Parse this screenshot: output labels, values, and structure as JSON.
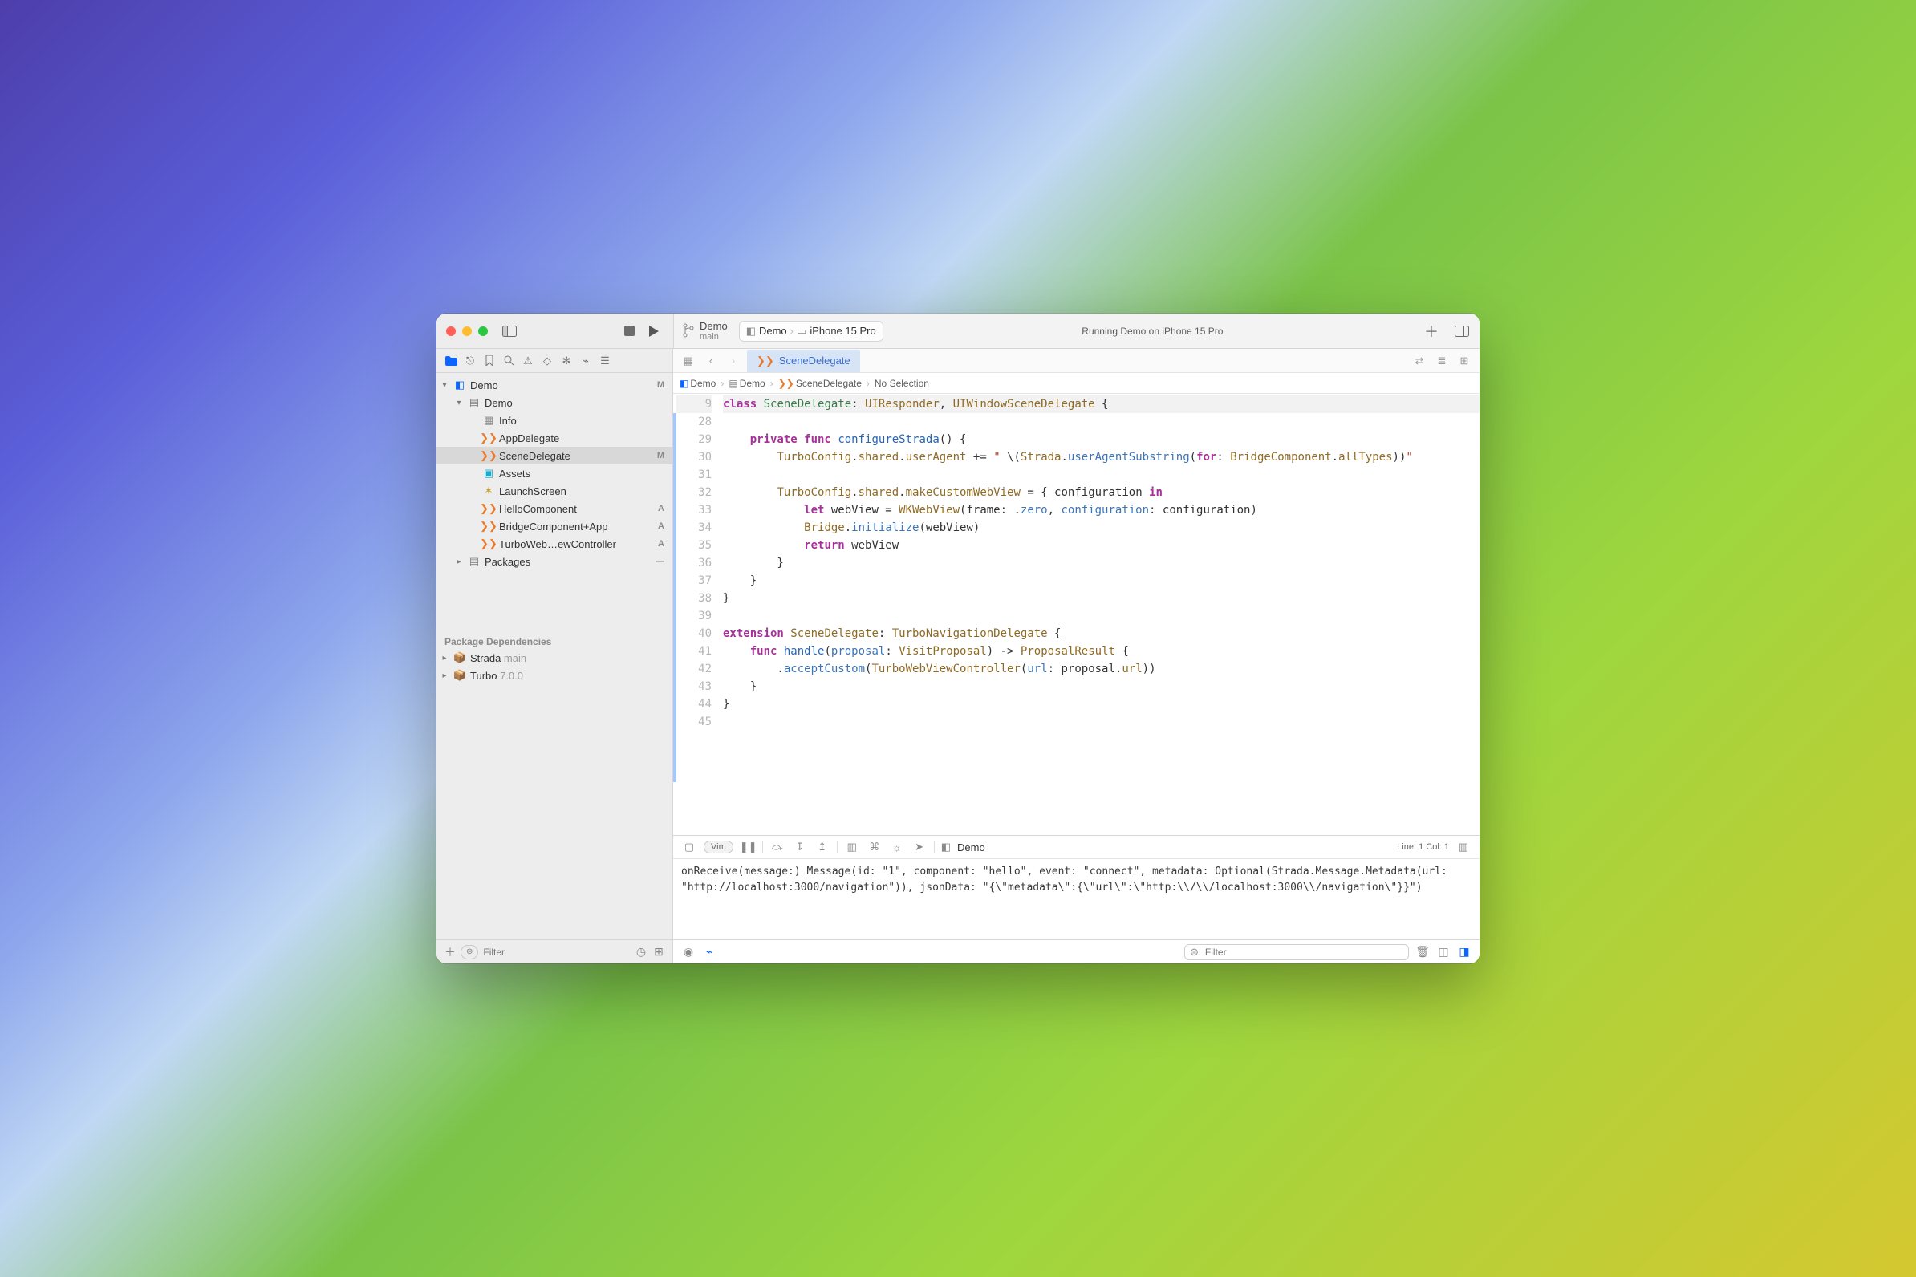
{
  "titlebar": {
    "branch_name": "Demo",
    "branch_sub": "main",
    "scheme_target": "Demo",
    "scheme_device": "iPhone 15 Pro",
    "status": "Running Demo on iPhone 15 Pro"
  },
  "sidebar": {
    "filter_placeholder": "Filter",
    "items": [
      {
        "depth": 0,
        "chev": "▾",
        "icon": "app",
        "label": "Demo",
        "badge": "M",
        "selected": false
      },
      {
        "depth": 1,
        "chev": "▾",
        "icon": "folder",
        "label": "Demo",
        "badge": "",
        "selected": false
      },
      {
        "depth": 2,
        "chev": "",
        "icon": "grid",
        "label": "Info",
        "badge": "",
        "selected": false
      },
      {
        "depth": 2,
        "chev": "",
        "icon": "swift",
        "label": "AppDelegate",
        "badge": "",
        "selected": false
      },
      {
        "depth": 2,
        "chev": "",
        "icon": "swift",
        "label": "SceneDelegate",
        "badge": "M",
        "selected": true
      },
      {
        "depth": 2,
        "chev": "",
        "icon": "assets",
        "label": "Assets",
        "badge": "",
        "selected": false
      },
      {
        "depth": 2,
        "chev": "",
        "icon": "storyboard",
        "label": "LaunchScreen",
        "badge": "",
        "selected": false
      },
      {
        "depth": 2,
        "chev": "",
        "icon": "swift",
        "label": "HelloComponent",
        "badge": "A",
        "selected": false
      },
      {
        "depth": 2,
        "chev": "",
        "icon": "swift",
        "label": "BridgeComponent+App",
        "badge": "A",
        "selected": false
      },
      {
        "depth": 2,
        "chev": "",
        "icon": "swift",
        "label": "TurboWeb…ewController",
        "badge": "A",
        "selected": false
      },
      {
        "depth": 1,
        "chev": "▸",
        "icon": "folder",
        "label": "Packages",
        "badge": "—",
        "selected": false
      }
    ],
    "deps_title": "Package Dependencies",
    "deps": [
      {
        "name": "Strada",
        "ver": "main"
      },
      {
        "name": "Turbo",
        "ver": "7.0.0"
      }
    ]
  },
  "tabs": {
    "active": "SceneDelegate"
  },
  "jumpbar": [
    "Demo",
    "Demo",
    "SceneDelegate",
    "No Selection"
  ],
  "editor": {
    "first_line_no": 9,
    "line_count": 16,
    "lines": [
      {
        "n": 9,
        "hl": true,
        "html": "<span class='kw'>class</span> <span class='type'>SceneDelegate</span>: <span class='attr'>UIResponder</span>, <span class='attr'>UIWindowSceneDelegate</span> {"
      },
      {
        "n": 28,
        "html": ""
      },
      {
        "n": 29,
        "html": "    <span class='kw'>private func</span> <span class='fn'>configureStrada</span>() {"
      },
      {
        "n": 30,
        "html": "        <span class='attr'>TurboConfig</span>.<span class='attr'>shared</span>.<span class='attr'>userAgent</span> += <span class='str'>\" </span>\\(<span class='attr'>Strada</span>.<span class='ident'>userAgentSubstring</span>(<span class='kw'>for</span>: <span class='attr'>BridgeComponent</span>.<span class='attr'>allTypes</span>))<span class='str'>\"</span>"
      },
      {
        "n": 31,
        "html": ""
      },
      {
        "n": 32,
        "html": "        <span class='attr'>TurboConfig</span>.<span class='attr'>shared</span>.<span class='attr'>makeCustomWebView</span> = { configuration <span class='kw'>in</span>"
      },
      {
        "n": 33,
        "html": "            <span class='kw'>let</span> webView = <span class='attr'>WKWebView</span>(frame: .<span class='ident'>zero</span>, <span class='ident'>configuration</span>: configuration)"
      },
      {
        "n": 34,
        "html": "            <span class='attr'>Bridge</span>.<span class='ident'>initialize</span>(webView)"
      },
      {
        "n": 35,
        "html": "            <span class='kw'>return</span> webView"
      },
      {
        "n": 36,
        "html": "        }"
      },
      {
        "n": 37,
        "html": "    }"
      },
      {
        "n": 38,
        "html": "}"
      },
      {
        "n": 39,
        "html": ""
      },
      {
        "n": 40,
        "html": "<span class='kw'>extension</span> <span class='attr'>SceneDelegate</span>: <span class='attr'>TurboNavigationDelegate</span> {"
      },
      {
        "n": 41,
        "html": "    <span class='kw'>func</span> <span class='fn'>handle</span>(<span class='ident'>proposal</span>: <span class='attr'>VisitProposal</span>) -> <span class='attr'>ProposalResult</span> {"
      },
      {
        "n": 42,
        "html": "        .<span class='ident'>acceptCustom</span>(<span class='attr'>TurboWebViewController</span>(<span class='ident'>url</span>: proposal.<span class='attr'>url</span>))"
      },
      {
        "n": 43,
        "html": "    }"
      },
      {
        "n": 44,
        "html": "}"
      },
      {
        "n": 45,
        "html": ""
      }
    ]
  },
  "debug": {
    "mode_label": "Vim",
    "process": "Demo",
    "cursor": "Line: 1  Col: 1",
    "filter_placeholder": "Filter",
    "console": "onReceive(message:) Message(id: \"1\", component: \"hello\", event: \"connect\", metadata: Optional(Strada.Message.Metadata(url: \"http://localhost:3000/navigation\")), jsonData: \"{\\\"metadata\\\":{\\\"url\\\":\\\"http:\\\\/\\\\/localhost:3000\\\\/navigation\\\"}}\")"
  }
}
